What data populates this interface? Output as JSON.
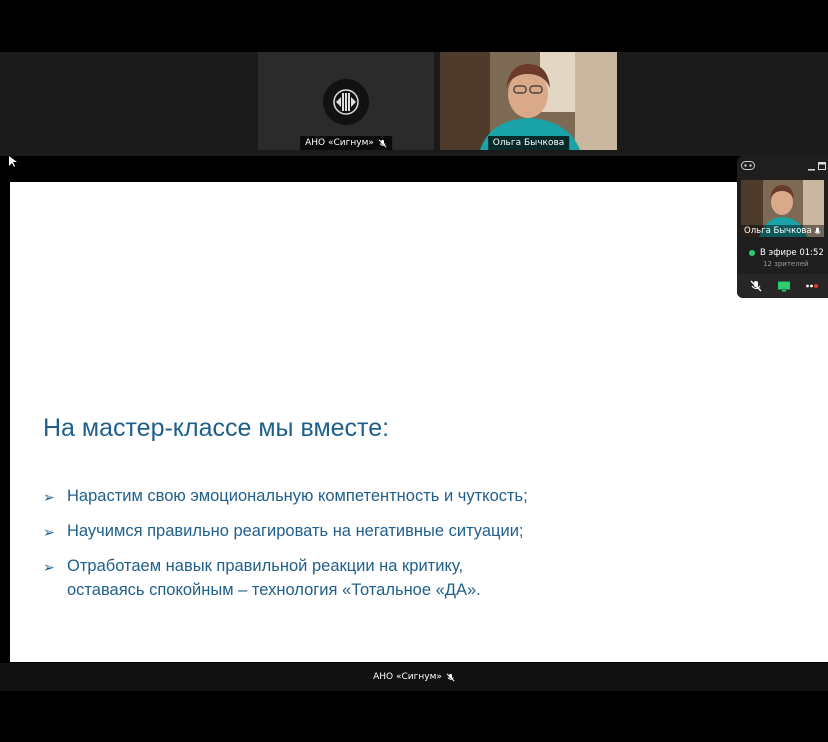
{
  "gallery": {
    "org_tile": {
      "name": "АНО «Сигнум»",
      "muted": true
    },
    "camera_tile": {
      "name": "Ольга Бычкова"
    }
  },
  "slide": {
    "title": "На мастер-классе мы вместе:",
    "bullets": [
      {
        "line1": "Нарастим свою эмоциональную компетентность и чуткость;",
        "line2": ""
      },
      {
        "line1": "Научимся правильно реагировать на негативные ситуации;",
        "line2": ""
      },
      {
        "line1": "Отработаем навык правильной реакции на критику,",
        "line2": "оставаясь спокойным – технология «Тотальное «ДА»."
      }
    ]
  },
  "share_footer": {
    "label": "АНО «Сигнум»"
  },
  "mini_panel": {
    "participant_name": "Ольга Бычкова",
    "live_label": "В эфире 01:52",
    "viewers_label": "12 зрителей"
  },
  "colors": {
    "slide_text": "#1f5f8b",
    "live_indicator": "#2ecc71",
    "record_indicator": "#e53935"
  },
  "icons": [
    "pointer-icon",
    "org-logo-icon",
    "mute-icon",
    "mic-icon",
    "minimize-icon",
    "maximize-icon",
    "chat-icon",
    "screen-share-icon",
    "more-icon"
  ]
}
